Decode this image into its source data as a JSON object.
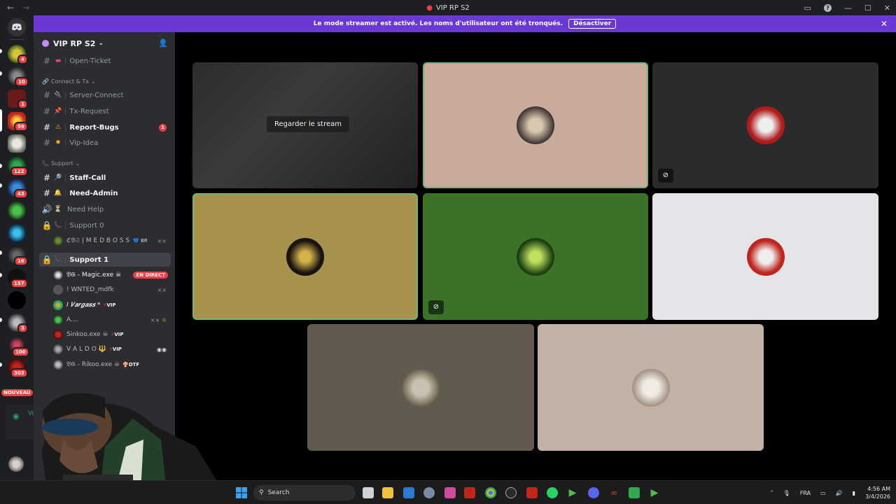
{
  "window": {
    "title": "VIP RP S2",
    "back_glyph": "←",
    "forward_glyph": "→"
  },
  "banner": {
    "text": "Le mode streamer est activé. Les noms d'utilisateur ont été tronqués.",
    "button_label": "Désactiver",
    "accent": "#6a38d2"
  },
  "rail": {
    "badges": [
      "4",
      "10",
      "1",
      "59",
      "122",
      "43",
      "16",
      "157",
      "3",
      "100",
      "303"
    ],
    "new_label": "NOUVEAU",
    "voice_label": "Vou"
  },
  "server": {
    "name": "VIP RP S2"
  },
  "channels": {
    "open_ticket": "Open-Ticket",
    "cat_connect": "Connect & Tx",
    "server_connect": "Server-Connect",
    "tx_request": "Tx-Request",
    "report_bugs": "Report-Bugs",
    "report_bugs_badge": "1",
    "vip_idea": "Vip-Idea",
    "cat_support": "Support",
    "staff_call": "Staff-Call",
    "need_admin": "Need-Admin",
    "need_help": "Need Help",
    "support0": "Support 0",
    "support1": "Support 1"
  },
  "users": {
    "medboss": "ℭ𝔅𝔖 | M E D B O S S",
    "medboss_tag": "💙 BR",
    "magic": "𝔅𝔊 - Magic.exe ☠",
    "live_label": "EN DIRECT",
    "wnted": "! WNTED_mdfk",
    "vargass": "I 𝑽𝒂𝒓𝒈𝒂𝒔𝒔 *",
    "vargass_vip": "VIP",
    "a_user": "A....",
    "sinkoo": "Sinkoo.exe ☠",
    "sinkoo_vip": "VIP",
    "valdo": "V A L D O 🔱",
    "valdo_vip": "VIP",
    "rikoo": "𝔅𝔊 - Rikoo.exe ☠",
    "rikoo_tag": "DTF"
  },
  "voice": {
    "watch_stream_label": "Regarder le stream"
  },
  "taskbar": {
    "search_placeholder": "Search",
    "language": "FRA",
    "time": "4:56 AM",
    "date": "3/4/2026"
  }
}
